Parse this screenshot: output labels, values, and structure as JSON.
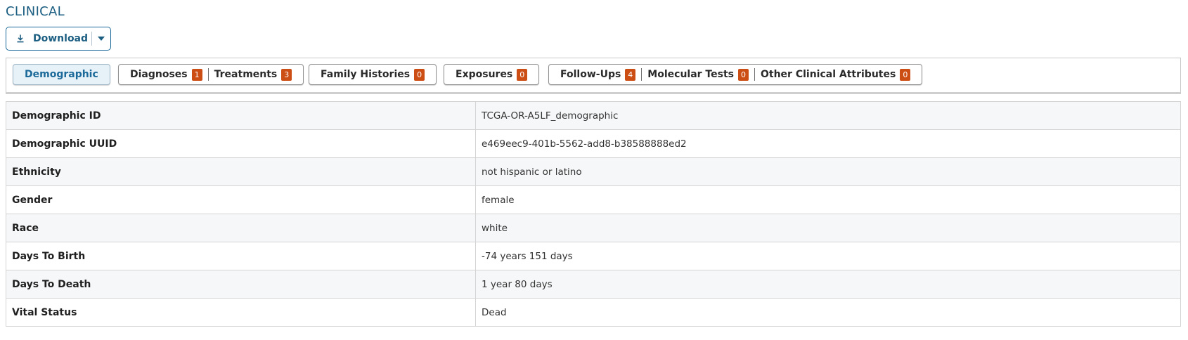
{
  "section_title": "CLINICAL",
  "download": {
    "label": "Download",
    "icon": "download-icon"
  },
  "tabs": [
    {
      "label": "Demographic",
      "active": true
    },
    {
      "label": "Diagnoses",
      "count": "1"
    },
    {
      "label": "Treatments",
      "count": "3"
    },
    {
      "label": "Family Histories",
      "count": "0"
    },
    {
      "label": "Exposures",
      "count": "0"
    },
    {
      "label": "Follow-Ups",
      "count": "4"
    },
    {
      "label": "Molecular Tests",
      "count": "0"
    },
    {
      "label": "Other Clinical Attributes",
      "count": "0"
    }
  ],
  "rows": [
    {
      "key": "Demographic ID",
      "value": "TCGA-OR-A5LF_demographic"
    },
    {
      "key": "Demographic UUID",
      "value": "e469eec9-401b-5562-add8-b38588888ed2"
    },
    {
      "key": "Ethnicity",
      "value": "not hispanic or latino"
    },
    {
      "key": "Gender",
      "value": "female"
    },
    {
      "key": "Race",
      "value": "white"
    },
    {
      "key": "Days To Birth",
      "value": "-74 years 151 days"
    },
    {
      "key": "Days To Death",
      "value": "1 year 80 days"
    },
    {
      "key": "Vital Status",
      "value": "Dead"
    }
  ],
  "colors": {
    "accent": "#1b5e82",
    "badge": "#cc4e14",
    "active_tab_bg": "#e6f1f8"
  }
}
